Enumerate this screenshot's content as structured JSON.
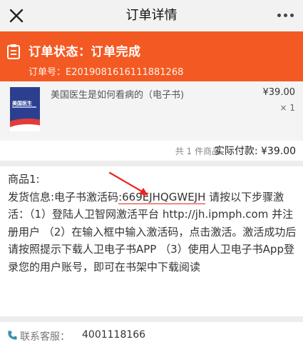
{
  "nav": {
    "title": "订单详情"
  },
  "status": {
    "label": "订单状态：订单完成",
    "order_no": "订单号：E20190816161118812​68"
  },
  "product": {
    "name": "美国医生是如何看病的（电子书)",
    "price": "¥39.00",
    "qty": "× 1",
    "cover_text": "美国医生"
  },
  "summary": {
    "count": "共 1 件商品",
    "total": "实际付款: ¥39.00"
  },
  "detail": {
    "heading": "商品1:",
    "info_prefix": "发货信息:电子书激活码",
    "code": ":669EJHQGWEJH",
    "instructions": " 请按以下步骤激活：（1）登陆人卫智网激活平台 http://jh.ipmph.com 并注册用户 （2）在输入框中输入激活码，点击激活。激活成功后请按照提示下载人卫电子书APP （3）使用人卫电子书App登录您的用户账号，即可在书架中下载阅读"
  },
  "service": {
    "label": "联系客服：",
    "phone": "4001118166"
  },
  "colors": {
    "accent": "#f35a23",
    "highlight": "#e22222"
  }
}
